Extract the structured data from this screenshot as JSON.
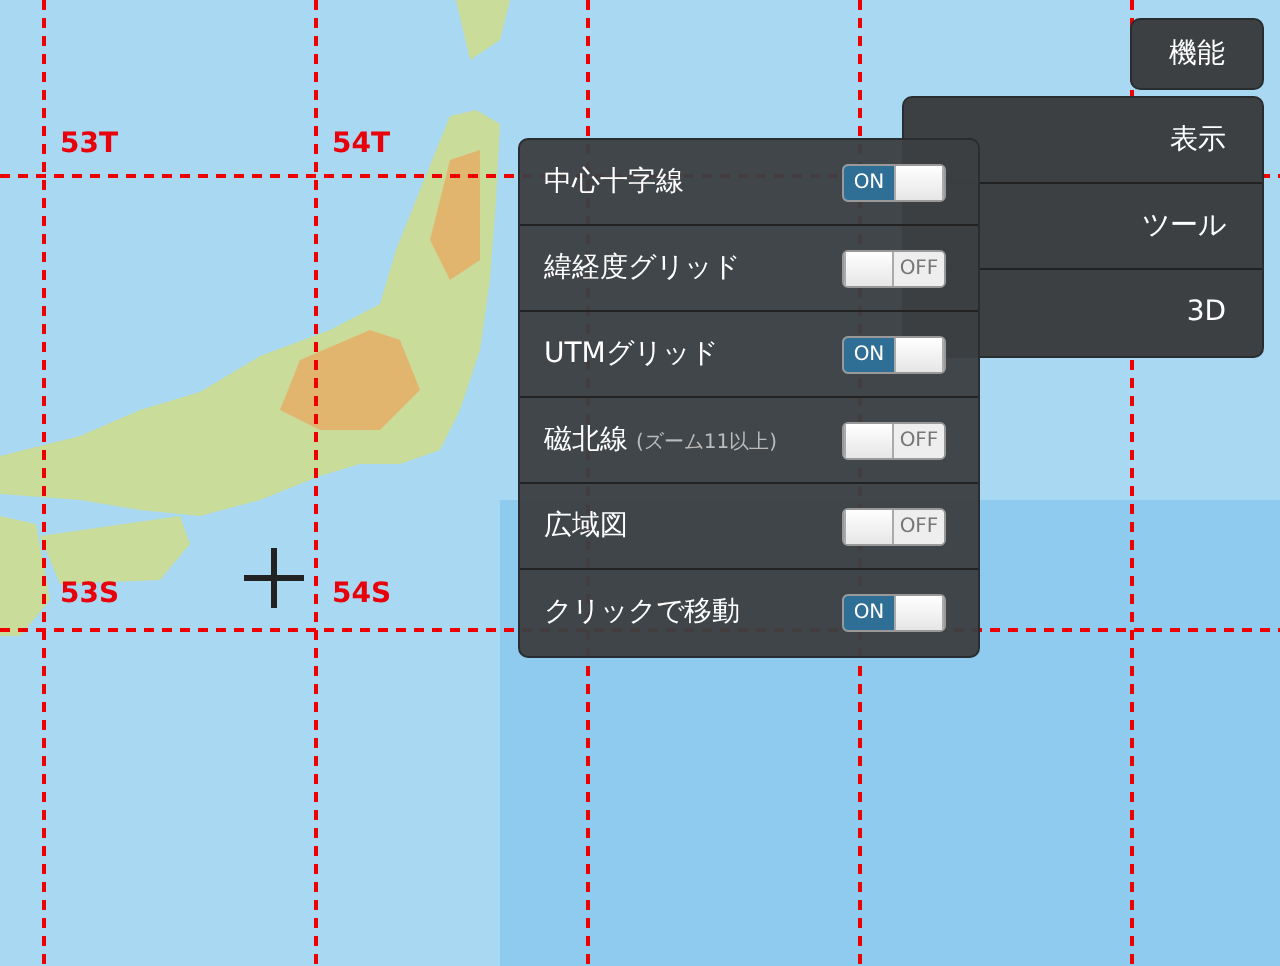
{
  "map": {
    "zones": [
      {
        "label": "53T"
      },
      {
        "label": "54T"
      },
      {
        "label": "53S"
      },
      {
        "label": "54S"
      }
    ]
  },
  "menu": {
    "button": "機能",
    "items": [
      {
        "label": "表示"
      },
      {
        "label": "ツール"
      },
      {
        "label": "3D"
      }
    ]
  },
  "settings": [
    {
      "label": "中心十字線",
      "on": true,
      "state_text": "ON"
    },
    {
      "label": "緯経度グリッド",
      "on": false,
      "state_text": "OFF"
    },
    {
      "label": "UTMグリッド",
      "on": true,
      "state_text": "ON"
    },
    {
      "label": "磁北線",
      "note": "(ズーム11以上)",
      "on": false,
      "state_text": "OFF"
    },
    {
      "label": "広域図",
      "on": false,
      "state_text": "OFF"
    },
    {
      "label": "クリックで移動",
      "on": true,
      "state_text": "ON"
    }
  ]
}
